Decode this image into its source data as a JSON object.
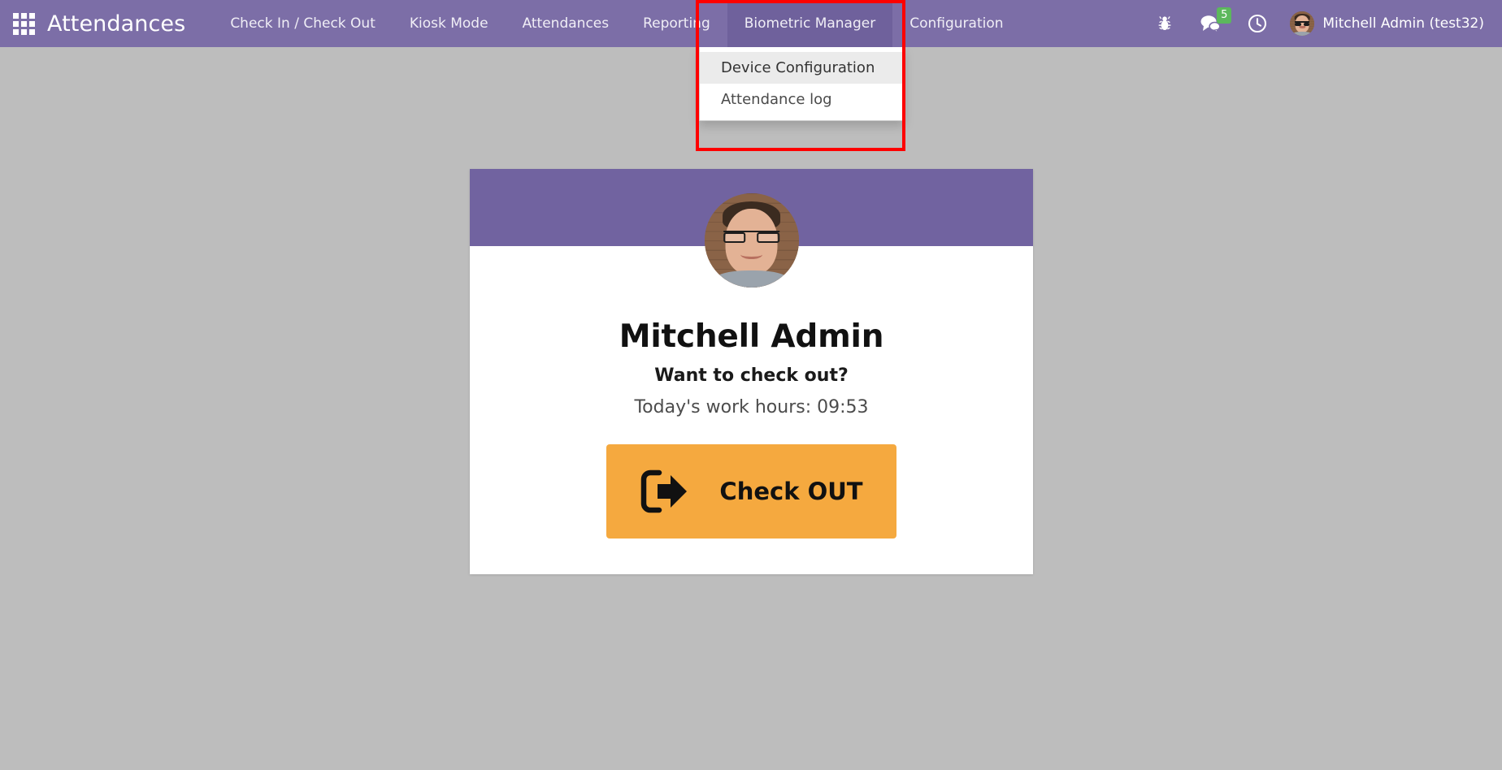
{
  "navbar": {
    "apps_icon": "apps-grid-icon",
    "brand": "Attendances",
    "menu_items": [
      {
        "label": "Check In / Check Out",
        "active": false
      },
      {
        "label": "Kiosk Mode",
        "active": false
      },
      {
        "label": "Attendances",
        "active": false
      },
      {
        "label": "Reporting",
        "active": false
      },
      {
        "label": "Biometric Manager",
        "active": true
      },
      {
        "label": "Configuration",
        "active": false
      }
    ],
    "right": {
      "debug_icon": "bug-icon",
      "messages_icon": "chat-bubbles-icon",
      "messages_count": "5",
      "activity_icon": "clock-icon",
      "user_avatar_icon": "user-avatar",
      "user_label": "Mitchell Admin (test32)"
    }
  },
  "dropdown": {
    "open_for": "Biometric Manager",
    "items": [
      {
        "label": "Device Configuration",
        "hovered": true
      },
      {
        "label": "Attendance log",
        "hovered": false
      }
    ]
  },
  "annotation": {
    "type": "red-highlight-box",
    "color": "#fe0000"
  },
  "kiosk_card": {
    "avatar_icon": "employee-photo",
    "employee_name": "Mitchell Admin",
    "prompt": "Want to check out?",
    "work_hours": "Today's work hours: 09:53",
    "button": {
      "icon": "sign-out-icon",
      "label": "Check OUT",
      "color": "#f5a93f"
    }
  },
  "theme": {
    "navbar_bg": "#7c6ea7",
    "navbar_active_bg": "#6f619c",
    "card_header_bg": "#7163a0",
    "page_bg": "#bdbdbd",
    "badge_green": "#5cb85c"
  }
}
